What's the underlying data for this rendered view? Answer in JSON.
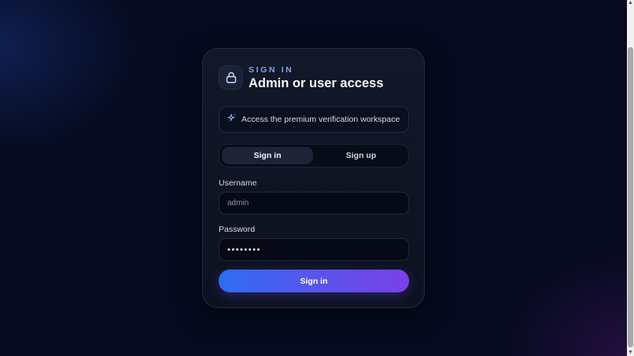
{
  "header": {
    "eyebrow": "SIGN IN",
    "title": "Admin or user access",
    "lock_icon": "lock-icon"
  },
  "banner": {
    "icon": "sparkle-icon",
    "text": "Access the premium verification workspace"
  },
  "tabs": [
    {
      "label": "Sign in",
      "active": true
    },
    {
      "label": "Sign up",
      "active": false
    }
  ],
  "form": {
    "username_label": "Username",
    "username_placeholder": "admin",
    "password_label": "Password",
    "password_value": "••••••••",
    "submit_label": "Sign in"
  },
  "colors": {
    "accent_start": "#2f6df0",
    "accent_end": "#7a40e6",
    "eyebrow": "#7aa3e8",
    "background": "#050a1f"
  }
}
